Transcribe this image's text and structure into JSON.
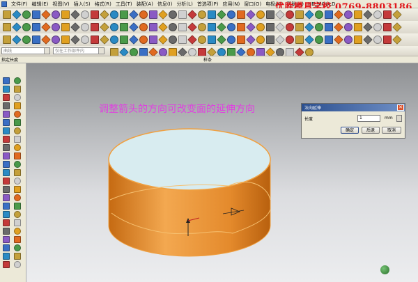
{
  "menubar": {
    "items": [
      "文件(F)",
      "编辑(E)",
      "视图(V)",
      "插入(S)",
      "格式(R)",
      "工具(T)",
      "装配(A)",
      "信息(I)",
      "分析(L)",
      "首选项(P)",
      "应用(N)",
      "窗口(O)",
      "电极(K)",
      "帮助(H)",
      "HB_MOULD"
    ]
  },
  "watermark": "优胜模具学校  0769-8803186",
  "toolbar_row5": {
    "left_label": "指定长度",
    "center_label": "样条"
  },
  "combos": {
    "filter": "曲线",
    "scope": "仅在工作部件内"
  },
  "viewport": {
    "instruction": "调整箭头的方向可改变面的延伸方向"
  },
  "dialog": {
    "title": "法向延伸",
    "length_label": "长度",
    "length_value": "1",
    "unit": "mm",
    "ok_label": "确定",
    "back_label": "后退",
    "cancel_label": "取消"
  },
  "colors": {
    "surface_side": "#e88a2a",
    "surface_top": "#d8ecf0",
    "instruction": "#e040e0",
    "watermark": "#e0151b"
  }
}
